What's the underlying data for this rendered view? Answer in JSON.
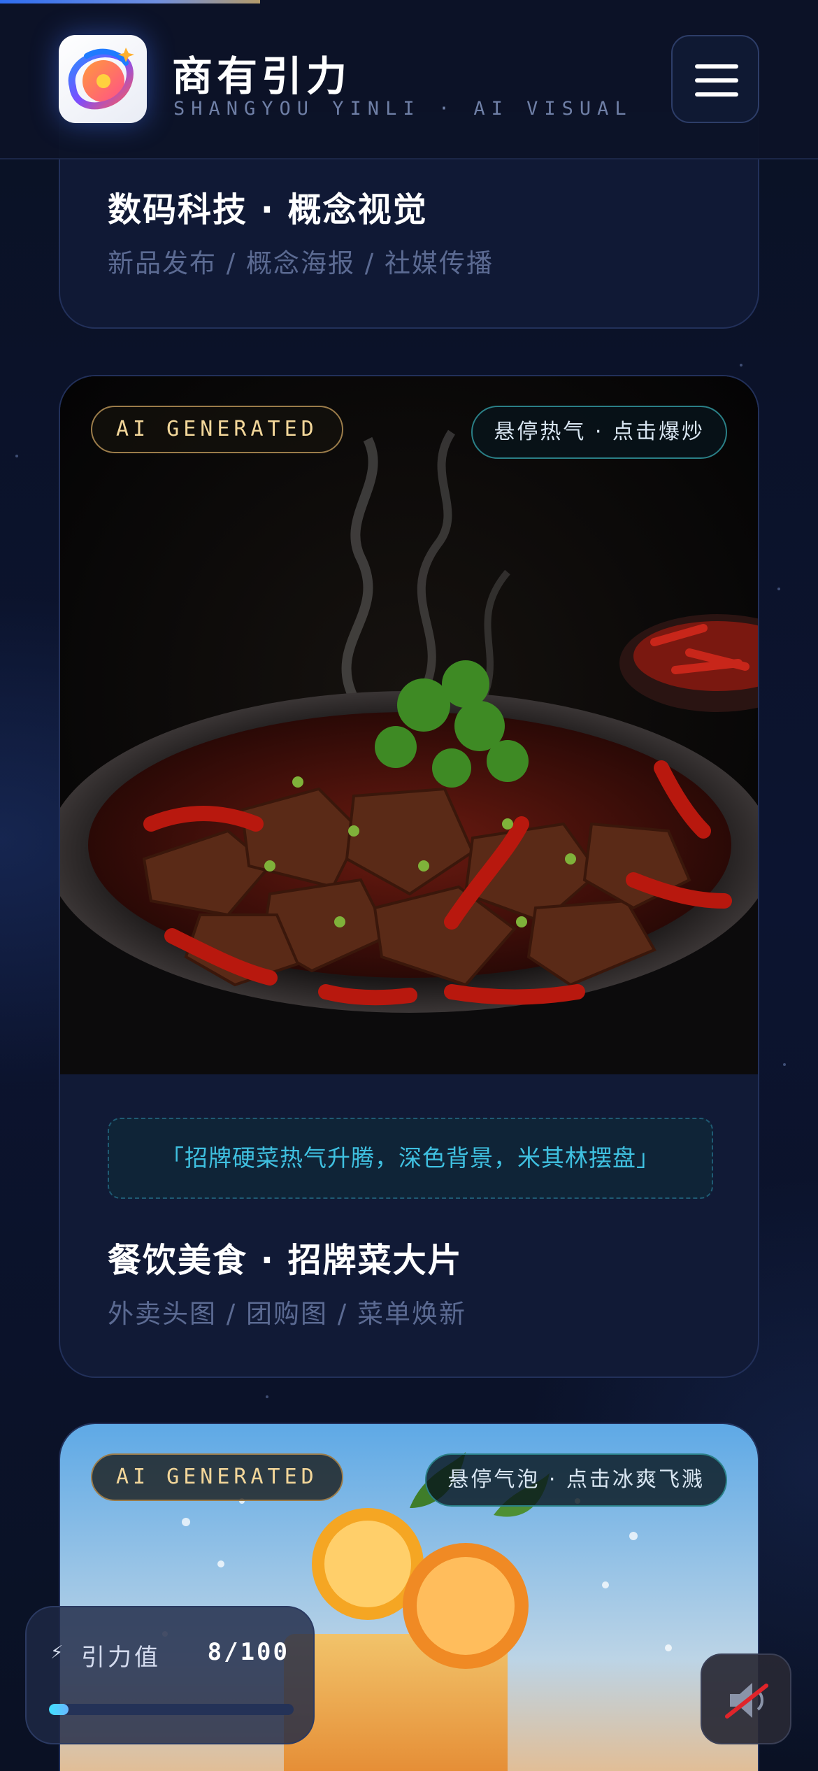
{
  "header": {
    "brand_name": "商有引力",
    "brand_sub": "SHANGYOU YINLI · AI VISUAL",
    "logo_icon": "planet-swirl-logo",
    "menu_icon": "hamburger-icon"
  },
  "cards": [
    {
      "title": "数码科技 · 概念视觉",
      "tags": "新品发布 / 概念海报 / 社媒传播"
    },
    {
      "badge": "AI GENERATED",
      "hint": "悬停热气 · 点击爆炒",
      "prompt": "「招牌硬菜热气升腾，深色背景，米其林摆盘」",
      "title": "餐饮美食 · 招牌菜大片",
      "tags": "外卖头图 / 团购图 / 菜单焕新"
    },
    {
      "badge": "AI GENERATED",
      "hint": "悬停气泡 · 点击冰爽飞溅"
    }
  ],
  "meter": {
    "icon": "lightning-icon",
    "label": "引力值",
    "value_text": "8/100",
    "fraction": 0.08
  },
  "sound": {
    "icon": "speaker-muted-icon"
  },
  "colors": {
    "accent_cyan": "#3fc0e0",
    "gold": "#f3d79a",
    "background": "#0b1226"
  }
}
